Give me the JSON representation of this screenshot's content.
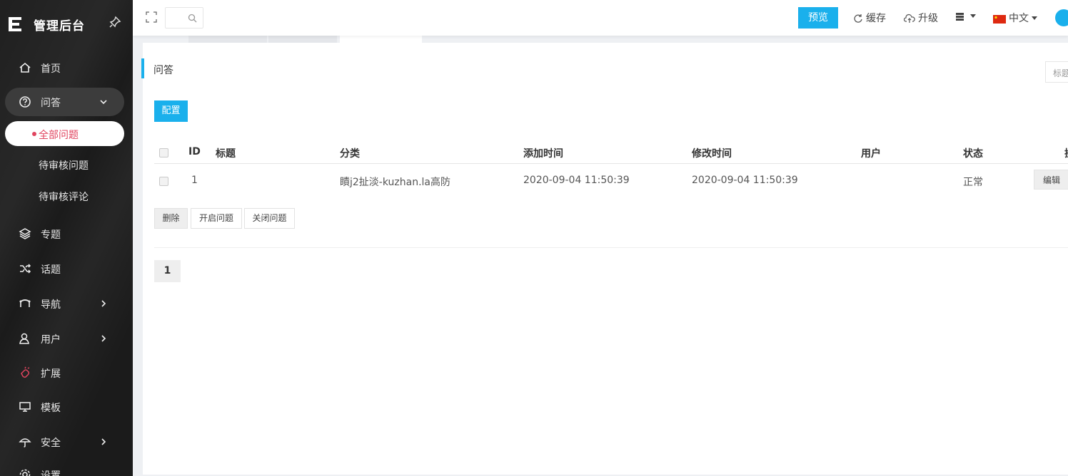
{
  "sidebar": {
    "brand": "管理后台",
    "items": [
      {
        "label": "首页"
      },
      {
        "label": "问答"
      },
      {
        "label": "专题"
      },
      {
        "label": "话题"
      },
      {
        "label": "导航"
      },
      {
        "label": "用户"
      },
      {
        "label": "扩展"
      },
      {
        "label": "模板"
      },
      {
        "label": "安全"
      },
      {
        "label": "设置"
      }
    ],
    "sub_items": [
      {
        "label": "全部问题"
      },
      {
        "label": "待审核问题"
      },
      {
        "label": "待审核评论"
      }
    ]
  },
  "topbar": {
    "preview_label": "预览",
    "cache_label": "缓存",
    "upgrade_label": "升级",
    "language_label": "中文"
  },
  "main": {
    "section_title": "问答",
    "search_placeholder": "标题",
    "config_label": "配置",
    "table": {
      "headers": [
        "ID",
        "标题",
        "分类",
        "添加时间",
        "修改时间",
        "用户",
        "状态",
        "操作"
      ],
      "rows": [
        {
          "id": "1",
          "title": "",
          "category": "瞔j2扯淡-kuzhan.la高防",
          "added": "2020-09-04 11:50:39",
          "modified": "2020-09-04 11:50:39",
          "user": "",
          "status": "正常",
          "edit_label": "编辑"
        }
      ]
    },
    "actions": {
      "delete_label": "删除",
      "open_label": "开启问题",
      "close_label": "关闭问题"
    },
    "pagination": {
      "current": "1"
    }
  },
  "colors": {
    "accent": "#1ab0ec",
    "active_red": "#e0455f",
    "sidebar_bg": "#1b1b1b"
  }
}
